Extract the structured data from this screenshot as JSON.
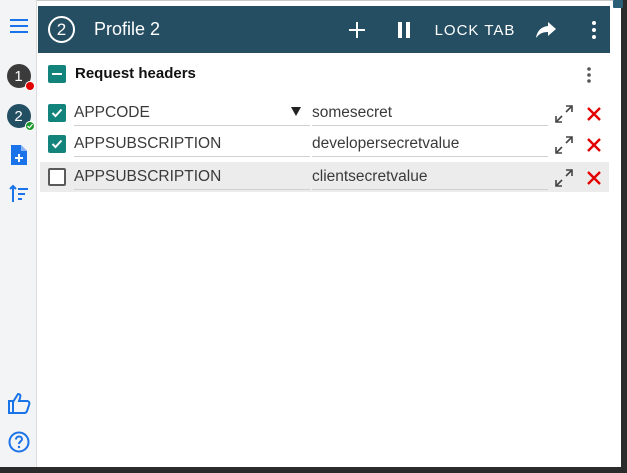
{
  "header": {
    "profile_number": "2",
    "title": "Profile 2",
    "lock_tab_label": "LOCK TAB",
    "bg_color": "#254e62"
  },
  "sidebar": {
    "profiles": [
      {
        "number": "1",
        "status": "red-dot"
      },
      {
        "number": "2",
        "status": "green-check"
      }
    ],
    "icons": [
      "menu-icon",
      "add-file-icon",
      "sort-icon",
      "thumbs-up-icon",
      "help-icon"
    ]
  },
  "section": {
    "title": "Request headers"
  },
  "rows": [
    {
      "enabled": true,
      "name": "APPCODE",
      "value": "somesecret",
      "has_dropdown": true
    },
    {
      "enabled": true,
      "name": "APPSUBSCRIPTION",
      "value": "developersecretvalue",
      "has_dropdown": false
    },
    {
      "enabled": false,
      "name": "APPSUBSCRIPTION",
      "value": "clientsecretvalue",
      "has_dropdown": false
    }
  ],
  "colors": {
    "accent_checkbox": "#12847c",
    "delete_red": "#e30000",
    "sidebar_blue": "#1a73e8"
  }
}
